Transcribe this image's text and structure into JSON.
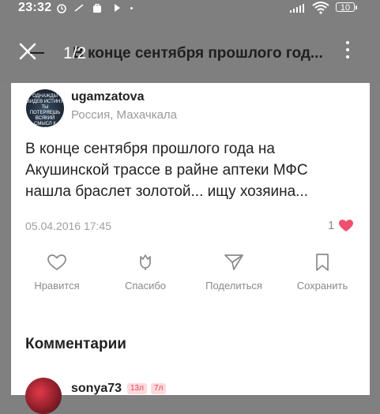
{
  "status_bar": {
    "time": "23:32",
    "battery": "10"
  },
  "app_bar": {
    "counter": "1/2",
    "title": "В конце сентября прошлого год..."
  },
  "post": {
    "avatar_text": "ОДНАЖДЫ ВИДЕВ ИСТИНУ ТЫ ПОТЕРЯЕШЬ ВСЯКИЙ СМЫСЛ К МИРСКОЙ ЖИЗНИ",
    "username": "ugamzatova",
    "location": "Россия, Махачкала",
    "text": "В конце сентября прошлого года на Акушинской трассе в райне аптеки МФС нашла браслет золотой... ищу хозяина...",
    "date": "05.04.2016 17:45",
    "likes_count": "1"
  },
  "actions": [
    {
      "label": "Нравится",
      "icon": "heart-outline-icon"
    },
    {
      "label": "Спасибо",
      "icon": "tulip-icon"
    },
    {
      "label": "Поделиться",
      "icon": "paper-plane-icon"
    },
    {
      "label": "Сохранить",
      "icon": "bookmark-icon"
    }
  ],
  "comments": {
    "title": "Комментарии",
    "items": [
      {
        "username": "sonya73",
        "badges": [
          "13л",
          "7л"
        ]
      }
    ]
  },
  "colors": {
    "accent_like": "#f0506e",
    "overlay": "#7f7f7f"
  }
}
